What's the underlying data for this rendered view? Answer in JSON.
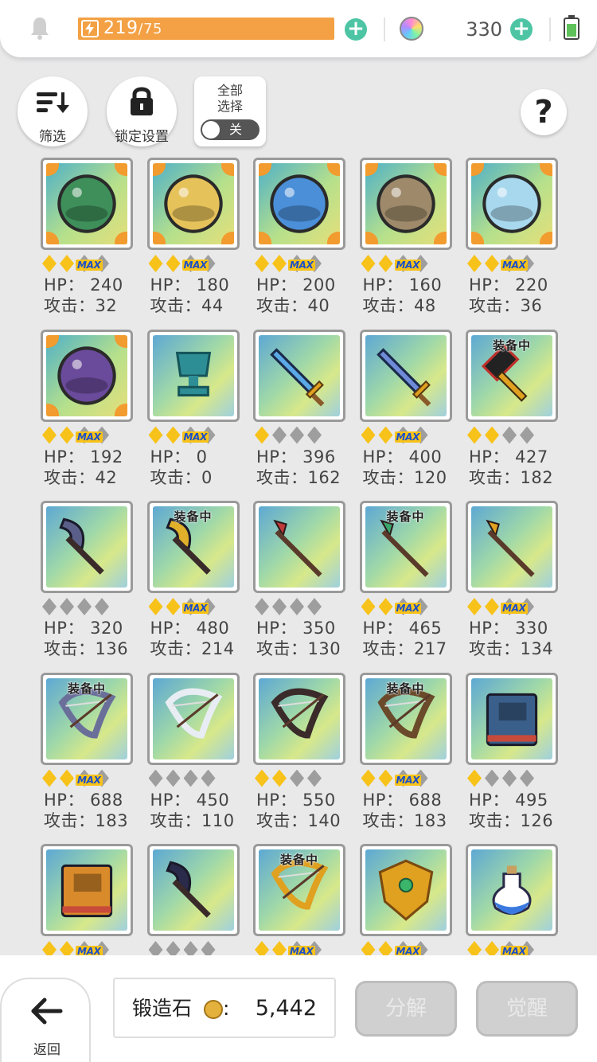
{
  "topbar": {
    "energy": "219",
    "energy_max": "/75",
    "gems": "330"
  },
  "toolbar": {
    "filter_label": "筛选",
    "lock_label": "锁定设置",
    "select_all_label": "全部\n选择",
    "toggle_label": "关"
  },
  "items": [
    {
      "row": 0,
      "col": 0,
      "kind": "ball",
      "scene": "garden",
      "gold": 2,
      "max": true,
      "equipped": false,
      "hp": "HP： 240",
      "atk": "攻击：32"
    },
    {
      "row": 0,
      "col": 1,
      "kind": "ball",
      "scene": "desert",
      "gold": 2,
      "max": true,
      "equipped": false,
      "hp": "HP： 180",
      "atk": "攻击：44"
    },
    {
      "row": 0,
      "col": 2,
      "kind": "ball",
      "scene": "ship",
      "gold": 2,
      "max": true,
      "equipped": false,
      "hp": "HP： 200",
      "atk": "攻击：40"
    },
    {
      "row": 0,
      "col": 3,
      "kind": "ball",
      "scene": "ruins",
      "gold": 2,
      "max": true,
      "equipped": false,
      "hp": "HP： 160",
      "atk": "攻击：48"
    },
    {
      "row": 0,
      "col": 4,
      "kind": "ball",
      "scene": "ice",
      "gold": 2,
      "max": true,
      "equipped": false,
      "hp": "HP： 220",
      "atk": "攻击：36"
    },
    {
      "row": 1,
      "col": 0,
      "kind": "ball",
      "scene": "cave",
      "gold": 2,
      "max": true,
      "equipped": false,
      "hp": "HP： 192",
      "atk": "攻击：42"
    },
    {
      "row": 1,
      "col": 1,
      "kind": "trophy",
      "gold": 2,
      "max": true,
      "equipped": false,
      "hp": "HP： 0",
      "atk": "攻击：0"
    },
    {
      "row": 1,
      "col": 2,
      "kind": "sword",
      "color": "#5aa9e6",
      "gold": 1,
      "max": false,
      "equipped": false,
      "hp": "HP： 396",
      "atk": "攻击：162"
    },
    {
      "row": 1,
      "col": 3,
      "kind": "sword",
      "color": "#6f8bd8",
      "gold": 2,
      "max": true,
      "equipped": false,
      "hp": "HP： 400",
      "atk": "攻击：120"
    },
    {
      "row": 1,
      "col": 4,
      "kind": "hammer",
      "color": "#222",
      "gold": 2,
      "max": false,
      "equipped": true,
      "hp": "HP： 427",
      "atk": "攻击：182"
    },
    {
      "row": 2,
      "col": 0,
      "kind": "axe",
      "color": "#5a5f8a",
      "gold": 0,
      "max": false,
      "equipped": false,
      "hp": "HP： 320",
      "atk": "攻击：136"
    },
    {
      "row": 2,
      "col": 1,
      "kind": "axe",
      "color": "#e0b02a",
      "gold": 2,
      "max": true,
      "equipped": true,
      "hp": "HP： 480",
      "atk": "攻击：214"
    },
    {
      "row": 2,
      "col": 2,
      "kind": "spear",
      "color": "#c03a3a",
      "gold": 0,
      "max": false,
      "equipped": false,
      "hp": "HP： 350",
      "atk": "攻击：130"
    },
    {
      "row": 2,
      "col": 3,
      "kind": "spear",
      "color": "#3aa56a",
      "gold": 2,
      "max": true,
      "equipped": true,
      "hp": "HP： 465",
      "atk": "攻击：217"
    },
    {
      "row": 2,
      "col": 4,
      "kind": "spear",
      "color": "#e0a020",
      "gold": 2,
      "max": true,
      "equipped": false,
      "hp": "HP： 330",
      "atk": "攻击：134"
    },
    {
      "row": 3,
      "col": 0,
      "kind": "bow",
      "color": "#6a6f9a",
      "gold": 2,
      "max": true,
      "equipped": true,
      "hp": "HP： 688",
      "atk": "攻击：183"
    },
    {
      "row": 3,
      "col": 1,
      "kind": "bow",
      "color": "#e8edf3",
      "gold": 0,
      "max": false,
      "equipped": false,
      "hp": "HP： 450",
      "atk": "攻击：110"
    },
    {
      "row": 3,
      "col": 2,
      "kind": "bow",
      "color": "#3a2a2a",
      "gold": 2,
      "max": false,
      "equipped": false,
      "hp": "HP： 550",
      "atk": "攻击：140"
    },
    {
      "row": 3,
      "col": 3,
      "kind": "bow",
      "color": "#6a4a2a",
      "gold": 2,
      "max": true,
      "equipped": true,
      "hp": "HP： 688",
      "atk": "攻击：183"
    },
    {
      "row": 3,
      "col": 4,
      "kind": "book",
      "color": "#3a5f8a",
      "gold": 1,
      "max": false,
      "equipped": false,
      "hp": "HP： 495",
      "atk": "攻击：126"
    },
    {
      "row": 4,
      "col": 0,
      "kind": "book",
      "color": "#d98a2a",
      "gold": 2,
      "max": true,
      "equipped": false,
      "hp": "",
      "atk": ""
    },
    {
      "row": 4,
      "col": 1,
      "kind": "axe",
      "color": "#2a2a4a",
      "gold": 0,
      "max": false,
      "equipped": false,
      "hp": "",
      "atk": ""
    },
    {
      "row": 4,
      "col": 2,
      "kind": "bow",
      "color": "#e0a020",
      "gold": 2,
      "max": true,
      "equipped": true,
      "hp": "",
      "atk": ""
    },
    {
      "row": 4,
      "col": 3,
      "kind": "shield",
      "color": "#e0a020",
      "gold": 2,
      "max": true,
      "equipped": false,
      "hp": "",
      "atk": ""
    },
    {
      "row": 4,
      "col": 4,
      "kind": "potion",
      "color": "#3a7ae0",
      "gold": 2,
      "max": true,
      "equipped": false,
      "hp": "",
      "atk": ""
    }
  ],
  "labels": {
    "equipped": "装备中",
    "max": "MAX"
  },
  "bottom": {
    "back_label": "返回",
    "stone_label": "锻造石",
    "stone_colon": ":",
    "stone_value": "5,442",
    "decompose_label": "分解",
    "awaken_label": "觉醒"
  },
  "colors": {
    "energy_bar": "#f3a144",
    "plus_button": "#4dc5a4",
    "gold_star": "#f7c21a",
    "silver_star": "#9e9e9e",
    "max_badge_text": "#1a4fc8",
    "disabled_button": "#d0d0d0"
  },
  "icons": [
    "bell-icon",
    "lightning-icon",
    "plus-icon",
    "rainbow-orb-icon",
    "battery-icon",
    "filter-sort-icon",
    "lock-icon",
    "help-icon",
    "back-arrow-icon",
    "forge-stone-icon"
  ]
}
